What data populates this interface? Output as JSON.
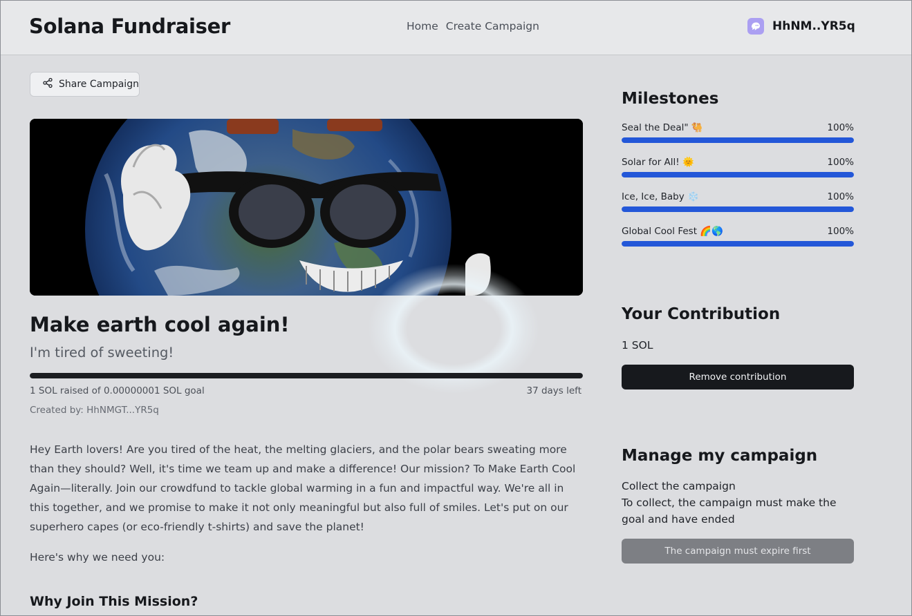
{
  "app": {
    "brand": "Solana Fundraiser",
    "nav": [
      {
        "label": "Home"
      },
      {
        "label": "Create Campaign"
      }
    ],
    "wallet": {
      "address": "HhNM..YR5q",
      "icon": "phantom-ghost-icon",
      "accent": "#ab9ff2"
    }
  },
  "campaign": {
    "share_label": "Share Campaign",
    "title": "Make earth cool again!",
    "subtitle": "I'm tired of sweeting!",
    "progress_fraction": 1.0,
    "raised_text": "1 SOL raised of 0.00000001 SOL goal",
    "days_left": "37 days left",
    "created_by": "Created by: HhNMGT...YR5q",
    "description": "Hey Earth lovers! Are you tired of the heat, the melting glaciers, and the polar bears sweating more than they should? Well, it's time we team up and make a difference! Our mission? To Make Earth Cool Again—literally. Join our crowdfund to tackle global warming in a fun and impactful way. We're all in this together, and we promise to make it not only meaningful but also full of smiles. Let's put on our superhero capes (or eco-friendly t-shirts) and save the planet!",
    "why_line": "Here's why we need you:",
    "section_heading": "Why Join This Mission?"
  },
  "milestones": {
    "heading": "Milestones",
    "items": [
      {
        "label": "Seal the Deal\" 🐫",
        "percent_text": "100%",
        "progress": 1.0
      },
      {
        "label": "Solar for All! 🌞",
        "percent_text": "100%",
        "progress": 1.0
      },
      {
        "label": "Ice, Ice, Baby ❄️",
        "percent_text": "100%",
        "progress": 1.0
      },
      {
        "label": "Global Cool Fest 🌈🌎",
        "percent_text": "100%",
        "progress": 1.0
      }
    ],
    "bar_color": "#2357d8"
  },
  "contribution": {
    "heading": "Your Contribution",
    "amount": "1 SOL",
    "remove_label": "Remove contribution"
  },
  "manage": {
    "heading": "Manage my campaign",
    "collect_title": "Collect the campaign",
    "collect_note": "To collect, the campaign must make the goal and have ended",
    "expire_label": "The campaign must expire first"
  }
}
